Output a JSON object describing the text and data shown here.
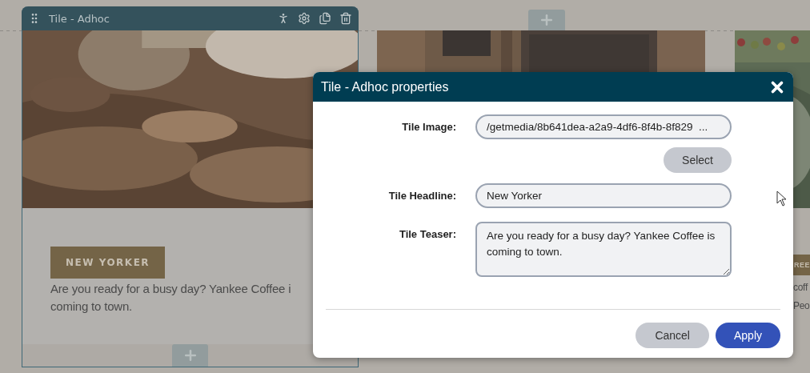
{
  "tiles": [
    {
      "kind": "adhoc",
      "title": "Tile - Adhoc",
      "headline": "NEW YORKER",
      "teaser": "Are you ready for a busy day? Yankee Coffee i\ncoming to town."
    },
    {
      "kind": "image_only"
    },
    {
      "kind": "partial",
      "headline": "REE",
      "teaser": "coff\nPeo"
    }
  ],
  "dialog": {
    "title": "Tile - Adhoc properties",
    "fields": [
      {
        "kind": "text",
        "label": "Tile Image:",
        "value": "/getmedia/8b641dea-a2a9-4df6-8f4b-8f829  ...",
        "button": "Select"
      },
      {
        "kind": "text",
        "label": "Tile Headline:",
        "value": "New Yorker"
      },
      {
        "kind": "textarea",
        "label": "Tile Teaser:",
        "value": "Are you ready for a busy day? Yankee Coffee is coming to town."
      }
    ],
    "buttons": [
      {
        "kind": "secondary",
        "label": "Cancel"
      },
      {
        "kind": "primary",
        "label": "Apply"
      }
    ]
  }
}
